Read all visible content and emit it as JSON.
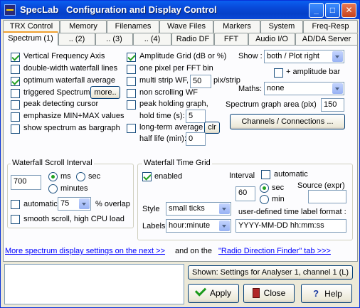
{
  "window": {
    "app_name": "SpecLab",
    "title": "Configuration and Display Control",
    "minimize": "_",
    "maximize": "□",
    "close": "✕"
  },
  "tabs_row1": [
    "TRX Control",
    "Memory",
    "Filenames",
    "Wave Files",
    "Markers",
    "System",
    "Freq-Resp"
  ],
  "tabs_row2": [
    "Spectrum (1)",
    ".. (2)",
    ".. (3)",
    ".. (4)",
    "Radio DF",
    "FFT",
    "Audio I/O",
    "AD/DA Server"
  ],
  "active_tab": "Spectrum (1)",
  "left_checks": [
    {
      "label": "Vertical Frequency Axis",
      "checked": true
    },
    {
      "label": "double-width waterfall lines",
      "checked": false
    },
    {
      "label": "optimum waterfall average",
      "checked": true
    },
    {
      "label": "triggered Spectrum",
      "checked": false
    },
    {
      "label": "peak detecting cursor",
      "checked": false
    },
    {
      "label": "emphasize MIN+MAX values",
      "checked": false
    },
    {
      "label": "show spectrum as bargraph",
      "checked": false
    }
  ],
  "more_button": "more..",
  "mid_checks": {
    "amplitude_grid": {
      "label": "Amplitude Grid (dB or %)",
      "checked": true
    },
    "one_pixel": {
      "label": "one pixel per FFT bin",
      "checked": false
    },
    "multi_strip": {
      "label": "multi strip WF,",
      "checked": false,
      "value": "50",
      "unit": "pix/strip"
    },
    "non_scrolling": {
      "label": "non scrolling WF",
      "checked": false
    },
    "peak_holding": {
      "label": "peak holding graph,",
      "checked": false
    },
    "hold_time_label": "hold time (s):",
    "hold_time_value": "5",
    "long_term": {
      "label": "long-term average",
      "checked": false
    },
    "clr_button": "clr",
    "half_life_label": "half life (min):",
    "half_life_value": "0"
  },
  "right_panel": {
    "show_label": "Show :",
    "show_value": "both / Plot  right",
    "amp_bar": {
      "label": "+ amplitude bar",
      "checked": false
    },
    "maths_label": "Maths:",
    "maths_value": "none",
    "graph_area_label": "Spectrum graph area (pix)",
    "graph_area_value": "150",
    "channels_button": "Channels / Connections ..."
  },
  "scroll_group": {
    "title": "Waterfall Scroll Interval",
    "interval_value": "700",
    "units": [
      {
        "label": "ms",
        "checked": true
      },
      {
        "label": "sec",
        "checked": false
      },
      {
        "label": "minutes",
        "checked": false
      }
    ],
    "automatic": {
      "label": "automatic:",
      "checked": false
    },
    "overlap_value": "75",
    "overlap_label": "% overlap",
    "smooth": {
      "label": "smooth scroll, high CPU load",
      "checked": false
    }
  },
  "time_grid_group": {
    "title": "Waterfall Time Grid",
    "enabled": {
      "label": "enabled",
      "checked": true
    },
    "interval_label": "Interval",
    "automatic": {
      "label": "automatic",
      "checked": false
    },
    "interval_value": "60",
    "units": [
      {
        "label": "sec",
        "checked": true
      },
      {
        "label": "min",
        "checked": false
      }
    ],
    "source_label": "Source (expr)",
    "source_value": "",
    "style_label": "Style",
    "style_value": "small ticks",
    "format_label": "user-defined time label format :",
    "labels_label": "Labels",
    "labels_value": "hour:minute",
    "format_value": "YYYY-MM-DD hh:mm:ss"
  },
  "footer_links": {
    "more_settings": "More spectrum display settings on the next >>",
    "and_on_the": "and on the",
    "rdf_tab": "\"Radio Direction Finder\" tab    >>>"
  },
  "status": {
    "shown": "Shown: Settings for Analyser 1, channel 1 (L)"
  },
  "buttons": {
    "apply": "Apply",
    "close": "Close",
    "help": "Help"
  }
}
